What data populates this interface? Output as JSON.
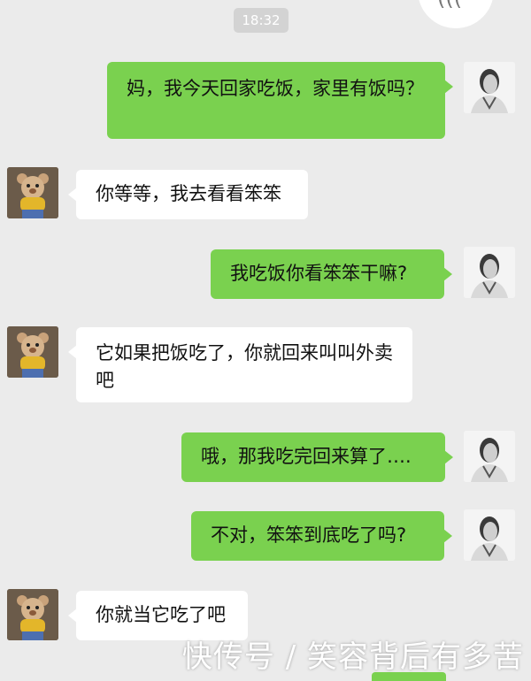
{
  "chat": {
    "time": "18:32",
    "messages": [
      {
        "from": "me",
        "text": "妈，我今天回家吃饭，家里有饭吗？"
      },
      {
        "from": "mom",
        "text": "你等等，我去看看笨笨"
      },
      {
        "from": "me",
        "text": "我吃饭你看笨笨干嘛?"
      },
      {
        "from": "mom",
        "text": "它如果把饭吃了，你就回来叫叫外卖吧"
      },
      {
        "from": "me",
        "text": "哦，那我吃完回来算了…."
      },
      {
        "from": "me",
        "text": "不对，笨笨到底吃了吗?"
      },
      {
        "from": "mom",
        "text": "你就当它吃了吧"
      }
    ]
  },
  "watermark": "快传号 / 笑容背后有多苦",
  "colors": {
    "background": "#ebebeb",
    "outgoing_bubble": "#7ad14f",
    "incoming_bubble": "#ffffff",
    "timestamp_bg": "#d3d3d3"
  },
  "icons": {
    "top_right": "voice-mode-icon",
    "contact_avatar": "teddy-bear-avatar-icon",
    "my_avatar": "man-portrait-avatar-icon"
  }
}
